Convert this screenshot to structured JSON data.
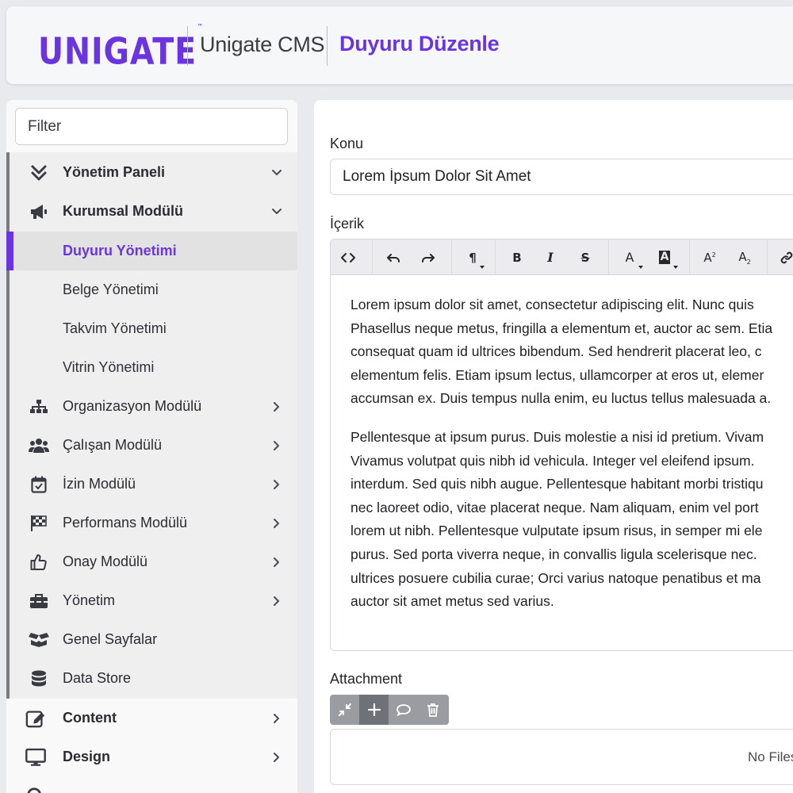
{
  "brand": {
    "logo_text": "UNIGATE",
    "logo_mark": "™",
    "app_name": "Unigate CMS",
    "page_title": "Duyuru Düzenle",
    "accent": "#6a35e0"
  },
  "sidebar": {
    "filter_placeholder": "Filter",
    "items": [
      {
        "label": "Yönetim Paneli",
        "icon": "double-chevron-down-icon",
        "chevron": "down"
      },
      {
        "label": "Kurumsal Modülü",
        "icon": "megaphone-icon",
        "chevron": "down"
      },
      {
        "label": "Duyuru Yönetimi",
        "active": true
      },
      {
        "label": "Belge Yönetimi"
      },
      {
        "label": "Takvim Yönetimi"
      },
      {
        "label": "Vitrin Yönetimi"
      },
      {
        "label": "Organizasyon Modülü",
        "icon": "sitemap-icon",
        "chevron": "right"
      },
      {
        "label": "Çalışan Modülü",
        "icon": "users-icon",
        "chevron": "right"
      },
      {
        "label": "İzin Modülü",
        "icon": "calendar-check-icon",
        "chevron": "right"
      },
      {
        "label": "Performans Modülü",
        "icon": "checkered-flag-icon",
        "chevron": "right"
      },
      {
        "label": "Onay Modülü",
        "icon": "thumbs-up-icon",
        "chevron": "right"
      },
      {
        "label": "Yönetim",
        "icon": "toolbox-icon",
        "chevron": "right"
      },
      {
        "label": "Genel Sayfalar",
        "icon": "box-open-icon"
      },
      {
        "label": "Data Store",
        "icon": "database-icon"
      },
      {
        "label": "Content",
        "icon": "edit-icon",
        "chevron": "right"
      },
      {
        "label": "Design",
        "icon": "monitor-icon",
        "chevron": "right"
      }
    ]
  },
  "form": {
    "subject_label": "Konu",
    "subject_value": "Lorem İpsum Dolor Sit Amet",
    "content_label": "İçerik",
    "toolbar": [
      "code-view-icon",
      "undo-icon",
      "redo-icon",
      "paragraph-icon",
      "bold-icon",
      "italic-icon",
      "strikethrough-icon",
      "font-color-icon",
      "background-color-icon",
      "superscript-icon",
      "subscript-icon",
      "link-icon"
    ],
    "paragraphs": [
      [
        "Lorem ipsum dolor sit amet, consectetur adipiscing elit. Nunc quis",
        "Phasellus neque metus, fringilla a elementum et, auctor ac sem. Etia",
        "consequat quam id ultrices bibendum. Sed hendrerit placerat leo, c",
        "elementum felis. Etiam ipsum lectus, ullamcorper at eros ut, elemer",
        "accumsan ex. Duis tempus nulla enim, eu luctus tellus malesuada a."
      ],
      [
        "Pellentesque at ipsum purus. Duis molestie a nisi id pretium. Vivam",
        "Vivamus volutpat quis nibh id vehicula. Integer vel eleifend ipsum.",
        "interdum. Sed quis nibh augue. Pellentesque habitant morbi tristiqu",
        "nec laoreet odio, vitae placerat neque. Nam aliquam, enim vel port",
        "lorem ut nibh. Pellentesque vulputate ipsum risus, in semper mi ele",
        "purus. Sed porta viverra neque, in convallis ligula scelerisque nec.",
        "ultrices posuere cubilia curae; Orci varius natoque penatibus et ma",
        "auctor sit amet metus sed varius."
      ]
    ],
    "attachment_label": "Attachment",
    "attachment_tools": [
      "compress-icon",
      "plus-icon",
      "comment-icon",
      "trash-icon"
    ],
    "no_files_text": "No Files"
  }
}
